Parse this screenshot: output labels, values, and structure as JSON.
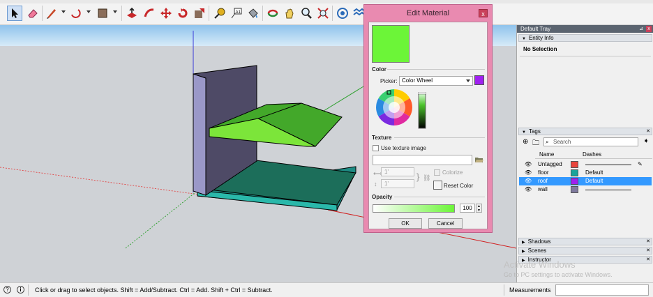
{
  "app": {
    "name": "SketchUp"
  },
  "statusbar": {
    "hint": "Click or drag to select objects. Shift = Add/Subtract. Ctrl = Add. Shift + Ctrl = Subtract.",
    "measurements_label": "Measurements"
  },
  "dialog": {
    "title": "Edit Material",
    "current_color": "#6cf538",
    "color_label": "Color",
    "picker_label": "Picker:",
    "picker_value": "Color Wheel",
    "picker_swatch_color": "#a020f0",
    "texture_label": "Texture",
    "use_texture_label": "Use texture image",
    "width_value": "1'",
    "height_value": "1'",
    "colorize_label": "Colorize",
    "reset_color_label": "Reset Color",
    "opacity_label": "Opacity",
    "opacity_value": "100",
    "ok_label": "OK",
    "cancel_label": "Cancel"
  },
  "tray": {
    "title": "Default Tray",
    "entity_info": {
      "label": "Entity Info",
      "content": "No Selection"
    },
    "tags": {
      "label": "Tags",
      "search_placeholder": "Search",
      "col_name": "Name",
      "col_dashes": "Dashes",
      "rows": [
        {
          "name": "Untagged",
          "color": "#e8453c",
          "dashes": "",
          "selected": false
        },
        {
          "name": "floor",
          "color": "#1aa39a",
          "dashes": "Default",
          "selected": false
        },
        {
          "name": "roof",
          "color": "#a020f0",
          "dashes": "Default",
          "selected": true
        },
        {
          "name": "wall",
          "color": "#7f7a9e",
          "dashes": "",
          "selected": false
        }
      ]
    },
    "collapsed_sections": [
      "Shadows",
      "Scenes",
      "Instructor"
    ]
  },
  "watermark": {
    "line1": "Activate Windows",
    "line2": "Go to PC settings to activate Windows."
  },
  "toolbar": {
    "tools": [
      "select-tool",
      "eraser-tool",
      "line-tool",
      "arc-tool",
      "shape-tool",
      "push-pull-tool",
      "follow-me-tool",
      "move-tool",
      "rotate-tool",
      "scale-tool",
      "tape-measure-tool",
      "text-tool",
      "paint-bucket-tool",
      "orbit-tool",
      "pan-tool",
      "zoom-tool",
      "zoom-extents-tool",
      "warehouse-tool",
      "extension-tool"
    ]
  }
}
